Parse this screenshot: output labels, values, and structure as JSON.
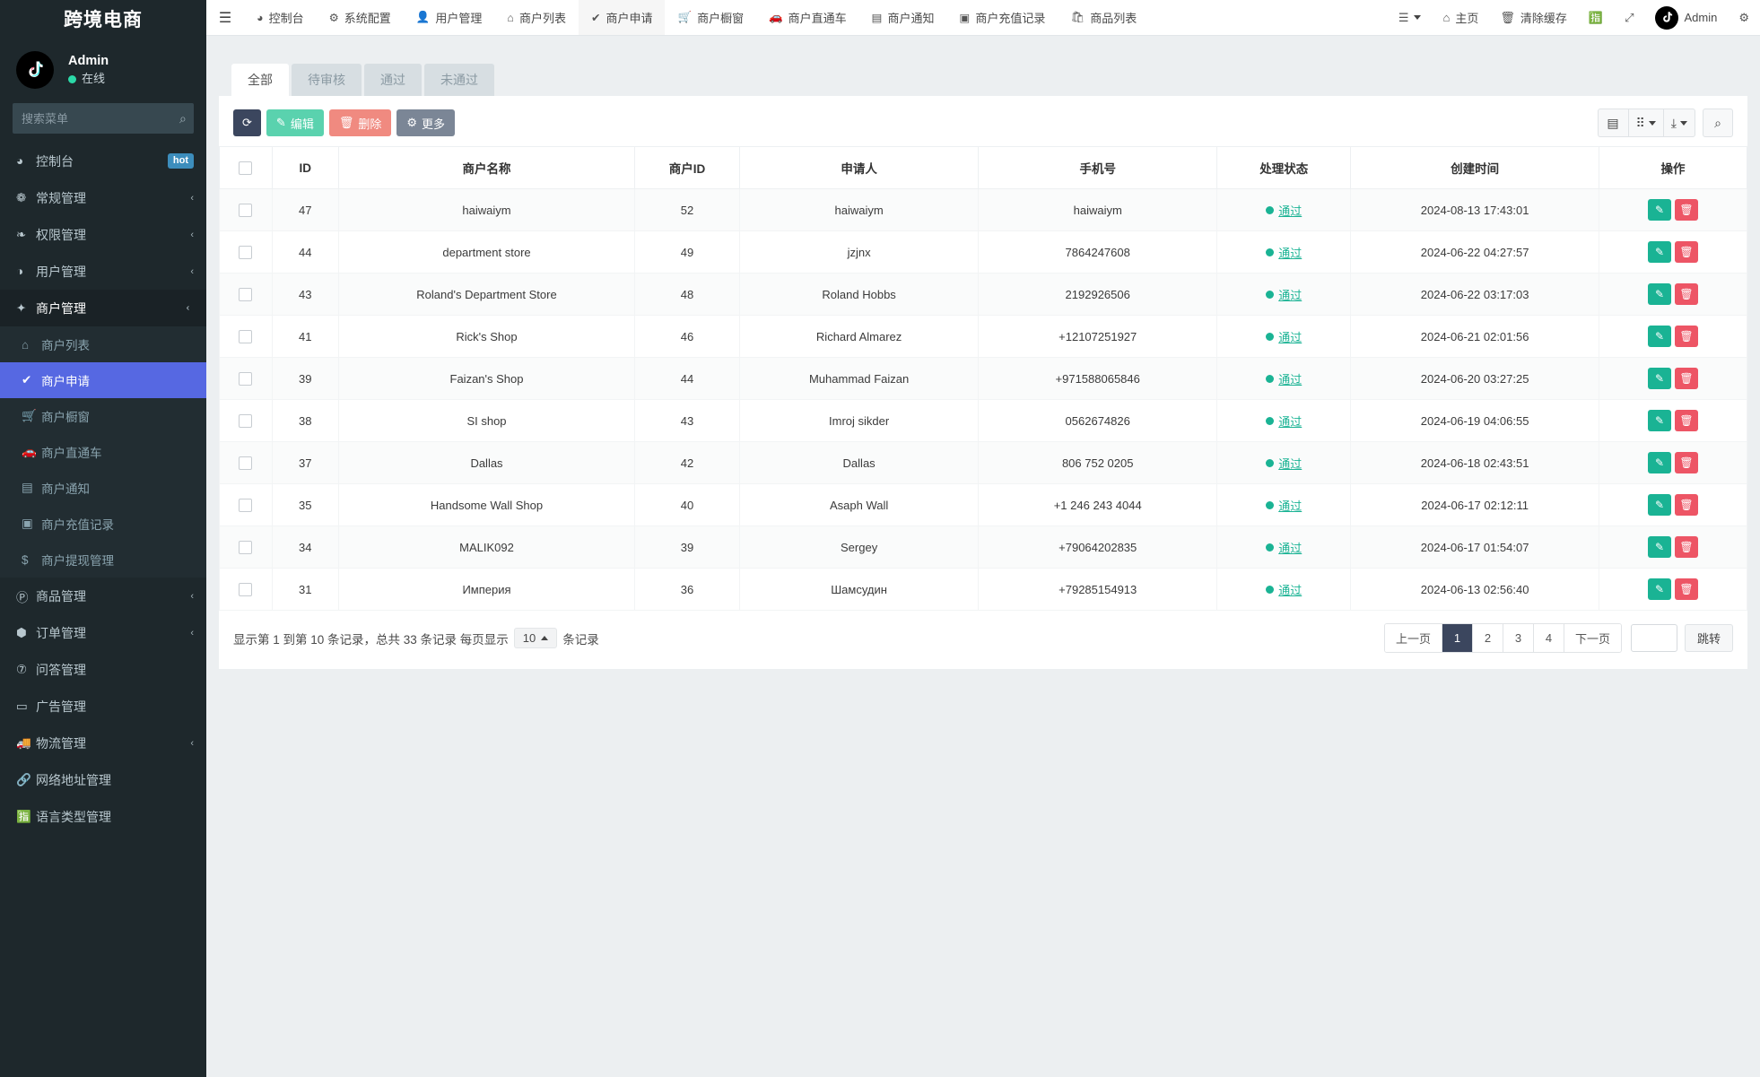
{
  "sidebar": {
    "brand": "跨境电商",
    "user": {
      "name": "Admin",
      "status": "在线"
    },
    "search_placeholder": "搜索菜单",
    "items": [
      {
        "label": "控制台",
        "icon": "dashboard-icon",
        "glyph": "◕",
        "badge": "hot"
      },
      {
        "label": "常规管理",
        "icon": "gears-icon",
        "glyph": "❁",
        "caret": "‹"
      },
      {
        "label": "权限管理",
        "icon": "users-icon",
        "glyph": "❧",
        "caret": "‹"
      },
      {
        "label": "用户管理",
        "icon": "user-circle-icon",
        "glyph": "◑",
        "caret": "‹"
      },
      {
        "label": "商户管理",
        "icon": "apple-icon",
        "glyph": "✦",
        "caret": "⌄",
        "open": true,
        "children": [
          {
            "label": "商户列表",
            "icon": "home-icon",
            "glyph": "⌂"
          },
          {
            "label": "商户申请",
            "icon": "check-circle-icon",
            "glyph": "✔",
            "active": true
          },
          {
            "label": "商户橱窗",
            "icon": "cart-icon",
            "glyph": "🛒"
          },
          {
            "label": "商户直通车",
            "icon": "car-icon",
            "glyph": "🚗"
          },
          {
            "label": "商户通知",
            "icon": "notice-icon",
            "glyph": "▤"
          },
          {
            "label": "商户充值记录",
            "icon": "money-icon",
            "glyph": "▣"
          },
          {
            "label": "商户提现管理",
            "icon": "dollar-icon",
            "glyph": "$"
          }
        ]
      },
      {
        "label": "商品管理",
        "icon": "product-icon",
        "glyph": "Ⓟ",
        "caret": "‹"
      },
      {
        "label": "订单管理",
        "icon": "order-icon",
        "glyph": "⬢",
        "caret": "‹"
      },
      {
        "label": "问答管理",
        "icon": "question-icon",
        "glyph": "⑦"
      },
      {
        "label": "广告管理",
        "icon": "ad-icon",
        "glyph": "▭"
      },
      {
        "label": "物流管理",
        "icon": "truck-icon",
        "glyph": "🚚",
        "caret": "‹"
      },
      {
        "label": "网络地址管理",
        "icon": "link-icon",
        "glyph": "🔗"
      },
      {
        "label": "语言类型管理",
        "icon": "language-icon",
        "glyph": "🈯"
      }
    ]
  },
  "topbar": {
    "menu_icon": "hamburger-icon",
    "nav": [
      {
        "label": "控制台",
        "icon": "dashboard-icon",
        "glyph": "◕"
      },
      {
        "label": "系统配置",
        "icon": "gear-icon",
        "glyph": "⚙"
      },
      {
        "label": "用户管理",
        "icon": "user-icon",
        "glyph": "👤"
      },
      {
        "label": "商户列表",
        "icon": "home-icon",
        "glyph": "⌂"
      },
      {
        "label": "商户申请",
        "icon": "check-circle-icon",
        "glyph": "✔",
        "active": true
      },
      {
        "label": "商户橱窗",
        "icon": "cart-icon",
        "glyph": "🛒"
      },
      {
        "label": "商户直通车",
        "icon": "car-icon",
        "glyph": "🚗"
      },
      {
        "label": "商户通知",
        "icon": "notice-icon",
        "glyph": "▤"
      },
      {
        "label": "商户充值记录",
        "icon": "money-icon",
        "glyph": "▣"
      },
      {
        "label": "商品列表",
        "icon": "bag-icon",
        "glyph": "🛍"
      }
    ],
    "right": [
      {
        "label": "",
        "icon": "list-menu-icon",
        "glyph": "☰",
        "caret": true
      },
      {
        "label": "主页",
        "icon": "home-icon",
        "glyph": "⌂"
      },
      {
        "label": "清除缓存",
        "icon": "trash-icon",
        "glyph": "🗑"
      },
      {
        "label": "",
        "icon": "language-switch-icon",
        "glyph": "🈯"
      },
      {
        "label": "",
        "icon": "fullscreen-icon",
        "glyph": "⤢"
      }
    ],
    "user_label": "Admin",
    "settings_icon": "gears-settings-icon"
  },
  "tabs": [
    {
      "label": "全部",
      "active": true
    },
    {
      "label": "待审核",
      "active": false
    },
    {
      "label": "通过",
      "active": false
    },
    {
      "label": "未通过",
      "active": false
    }
  ],
  "toolbar": {
    "refresh_icon": "refresh-icon",
    "edit_label": "编辑",
    "delete_label": "删除",
    "more_label": "更多",
    "columns_icon": "columns-icon",
    "grid_icon": "grid-icon",
    "export_icon": "export-icon",
    "search_icon": "search-icon"
  },
  "table": {
    "columns": [
      "",
      "ID",
      "商户名称",
      "商户ID",
      "申请人",
      "手机号",
      "处理状态",
      "创建时间",
      "操作"
    ],
    "rows": [
      {
        "id": "47",
        "name": "haiwaiym",
        "merchant_id": "52",
        "applicant": "haiwaiym",
        "phone": "haiwaiym",
        "status": "通过",
        "created": "2024-08-13 17:43:01"
      },
      {
        "id": "44",
        "name": "department store",
        "merchant_id": "49",
        "applicant": "jzjnx",
        "phone": "7864247608",
        "status": "通过",
        "created": "2024-06-22 04:27:57"
      },
      {
        "id": "43",
        "name": "Roland's Department Store",
        "merchant_id": "48",
        "applicant": "Roland Hobbs",
        "phone": "2192926506",
        "status": "通过",
        "created": "2024-06-22 03:17:03"
      },
      {
        "id": "41",
        "name": "Rick's Shop",
        "merchant_id": "46",
        "applicant": "Richard Almarez",
        "phone": "+12107251927",
        "status": "通过",
        "created": "2024-06-21 02:01:56"
      },
      {
        "id": "39",
        "name": "Faizan's Shop",
        "merchant_id": "44",
        "applicant": "Muhammad Faizan",
        "phone": "+971588065846",
        "status": "通过",
        "created": "2024-06-20 03:27:25"
      },
      {
        "id": "38",
        "name": "SI shop",
        "merchant_id": "43",
        "applicant": "Imroj sikder",
        "phone": "0562674826",
        "status": "通过",
        "created": "2024-06-19 04:06:55"
      },
      {
        "id": "37",
        "name": "Dallas",
        "merchant_id": "42",
        "applicant": "Dallas",
        "phone": "806 752 0205",
        "status": "通过",
        "created": "2024-06-18 02:43:51"
      },
      {
        "id": "35",
        "name": "Handsome Wall Shop",
        "merchant_id": "40",
        "applicant": "Asaph Wall",
        "phone": "+1 246 243 4044",
        "status": "通过",
        "created": "2024-06-17 02:12:11"
      },
      {
        "id": "34",
        "name": "MALIK092",
        "merchant_id": "39",
        "applicant": "Sergey",
        "phone": "+79064202835",
        "status": "通过",
        "created": "2024-06-17 01:54:07"
      },
      {
        "id": "31",
        "name": "Империя",
        "merchant_id": "36",
        "applicant": "Шамсудин",
        "phone": "+79285154913",
        "status": "通过",
        "created": "2024-06-13 02:56:40"
      }
    ]
  },
  "footer": {
    "summary_prefix": "显示第 1 到第 10 条记录，总共 33 条记录 每页显示",
    "page_size": "10",
    "summary_suffix": "条记录",
    "prev_label": "上一页",
    "pages": [
      "1",
      "2",
      "3",
      "4"
    ],
    "current_page": "1",
    "next_label": "下一页",
    "jump_value": "",
    "jump_label": "跳转"
  },
  "colors": {
    "sidebar_bg": "#1e282c",
    "active_menu": "#5668e2",
    "status_green": "#1ab394",
    "edit_btn": "#5ad2ae",
    "delete_btn": "#f08a80",
    "refresh_btn": "#3b465e",
    "hot_badge": "#3c8dbc"
  }
}
